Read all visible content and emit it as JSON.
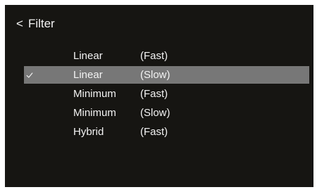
{
  "header": {
    "back_icon": "<",
    "title": "Filter"
  },
  "filters": [
    {
      "name": "Linear",
      "speed": "(Fast)",
      "selected": false,
      "checked": false
    },
    {
      "name": "Linear",
      "speed": "(Slow)",
      "selected": true,
      "checked": true
    },
    {
      "name": "Minimum",
      "speed": "(Fast)",
      "selected": false,
      "checked": false
    },
    {
      "name": "Minimum",
      "speed": "(Slow)",
      "selected": false,
      "checked": false
    },
    {
      "name": "Hybrid",
      "speed": "(Fast)",
      "selected": false,
      "checked": false
    }
  ],
  "icons": {
    "back": "chevron-left-icon",
    "check": "check-icon"
  },
  "colors": {
    "background": "#161512",
    "text": "#f3f3f3",
    "selected_row": "#777777"
  }
}
